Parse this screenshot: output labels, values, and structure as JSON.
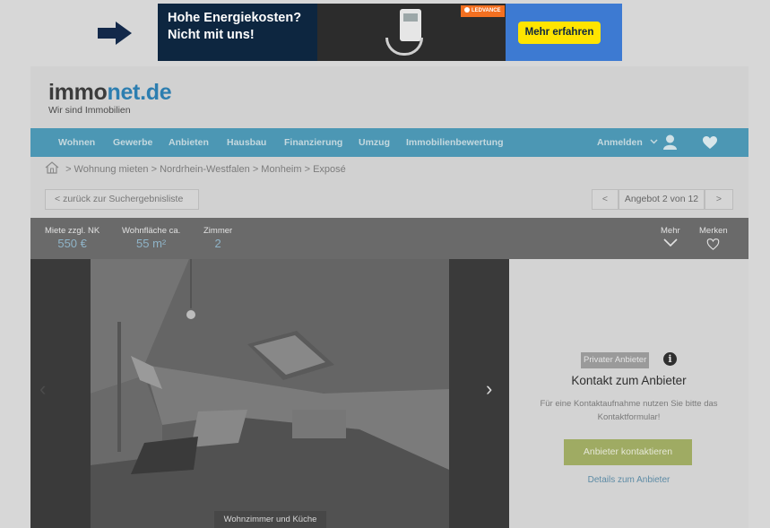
{
  "ad": {
    "headline_line1": "Hohe Energiekosten?",
    "headline_line2": "Nicht mit uns!",
    "brand": "LEDVANCE",
    "cta": "Mehr erfahren",
    "colors": {
      "background": "#0d2640",
      "cta": "#ffe400",
      "cta_panel": "#3d7ad2",
      "brand": "#f37021"
    }
  },
  "site": {
    "logo_part1": "immo",
    "logo_part2": "net.de",
    "tagline": "Wir sind Immobilien",
    "nav": [
      "Wohnen",
      "Gewerbe",
      "Anbieten",
      "Hausbau",
      "Finanzierung",
      "Umzug",
      "Immobilienbewertung"
    ],
    "login": "Anmelden",
    "icons": {
      "home": "home-icon",
      "user": "user-icon",
      "favorite": "heart-icon",
      "login_toggle": "chevron-down-icon"
    },
    "colors": {
      "nav": "#4c97b4",
      "accent": "#2d7eb0",
      "cta": "#9fab63"
    }
  },
  "breadcrumb": [
    "Wohnung mieten",
    "Nordrhein-Westfalen",
    "Monheim",
    "Exposé"
  ],
  "listing_nav": {
    "back": "zurück zur Suchergebnisliste",
    "counter": "Angebot 2 von 12"
  },
  "key_facts": [
    {
      "label": "Miete zzgl. NK",
      "value": "550 €"
    },
    {
      "label": "Wohnfläche ca.",
      "value": "55 m²"
    },
    {
      "label": "Zimmer",
      "value": "2"
    }
  ],
  "actions": {
    "more": "Mehr",
    "save": "Merken"
  },
  "gallery": {
    "caption": "Wohnzimmer und Küche"
  },
  "contact": {
    "badge": "Privater Anbieter",
    "title": "Kontakt zum Anbieter",
    "text": "Für eine Kontaktaufnahme nutzen Sie bitte das Kontaktformular!",
    "button": "Anbieter kontaktieren",
    "link": "Details zum Anbieter"
  }
}
